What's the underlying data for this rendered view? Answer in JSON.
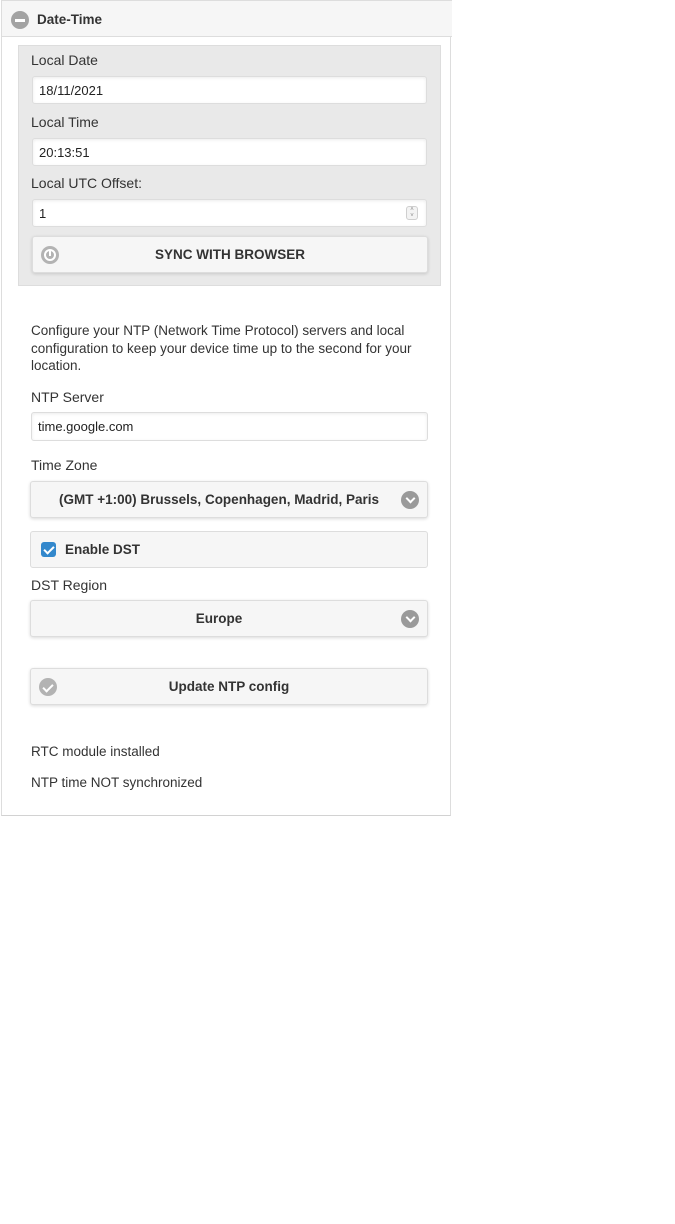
{
  "panel": {
    "title": "Date-Time",
    "collapse_icon": "minus-circle-icon"
  },
  "datetime": {
    "local_date_label": "Local Date",
    "local_date_value": "18/11/2021",
    "local_time_label": "Local Time",
    "local_time_value": "20:13:51",
    "utc_offset_label": "Local UTC Offset:",
    "utc_offset_value": "1",
    "sync_button_label": "SYNC WITH BROWSER",
    "sync_button_icon": "clock-icon"
  },
  "ntp": {
    "description": "Configure your NTP (Network Time Protocol) servers and local configuration to keep your device time up to the second for your location.",
    "server_label": "NTP Server",
    "server_value": "time.google.com",
    "timezone_label": "Time Zone",
    "timezone_value": "(GMT +1:00) Brussels, Copenhagen, Madrid, Paris",
    "enable_dst_label": "Enable DST",
    "enable_dst_checked": true,
    "dst_region_label": "DST Region",
    "dst_region_value": "Europe",
    "update_button_label": "Update NTP config",
    "update_button_icon": "check-icon"
  },
  "status": {
    "rtc": "RTC module installed",
    "ntp_sync": "NTP time NOT synchronized"
  },
  "colors": {
    "accent": "#3388cc",
    "box_bg": "#e9e9e9",
    "button_bg": "#f6f6f6"
  }
}
